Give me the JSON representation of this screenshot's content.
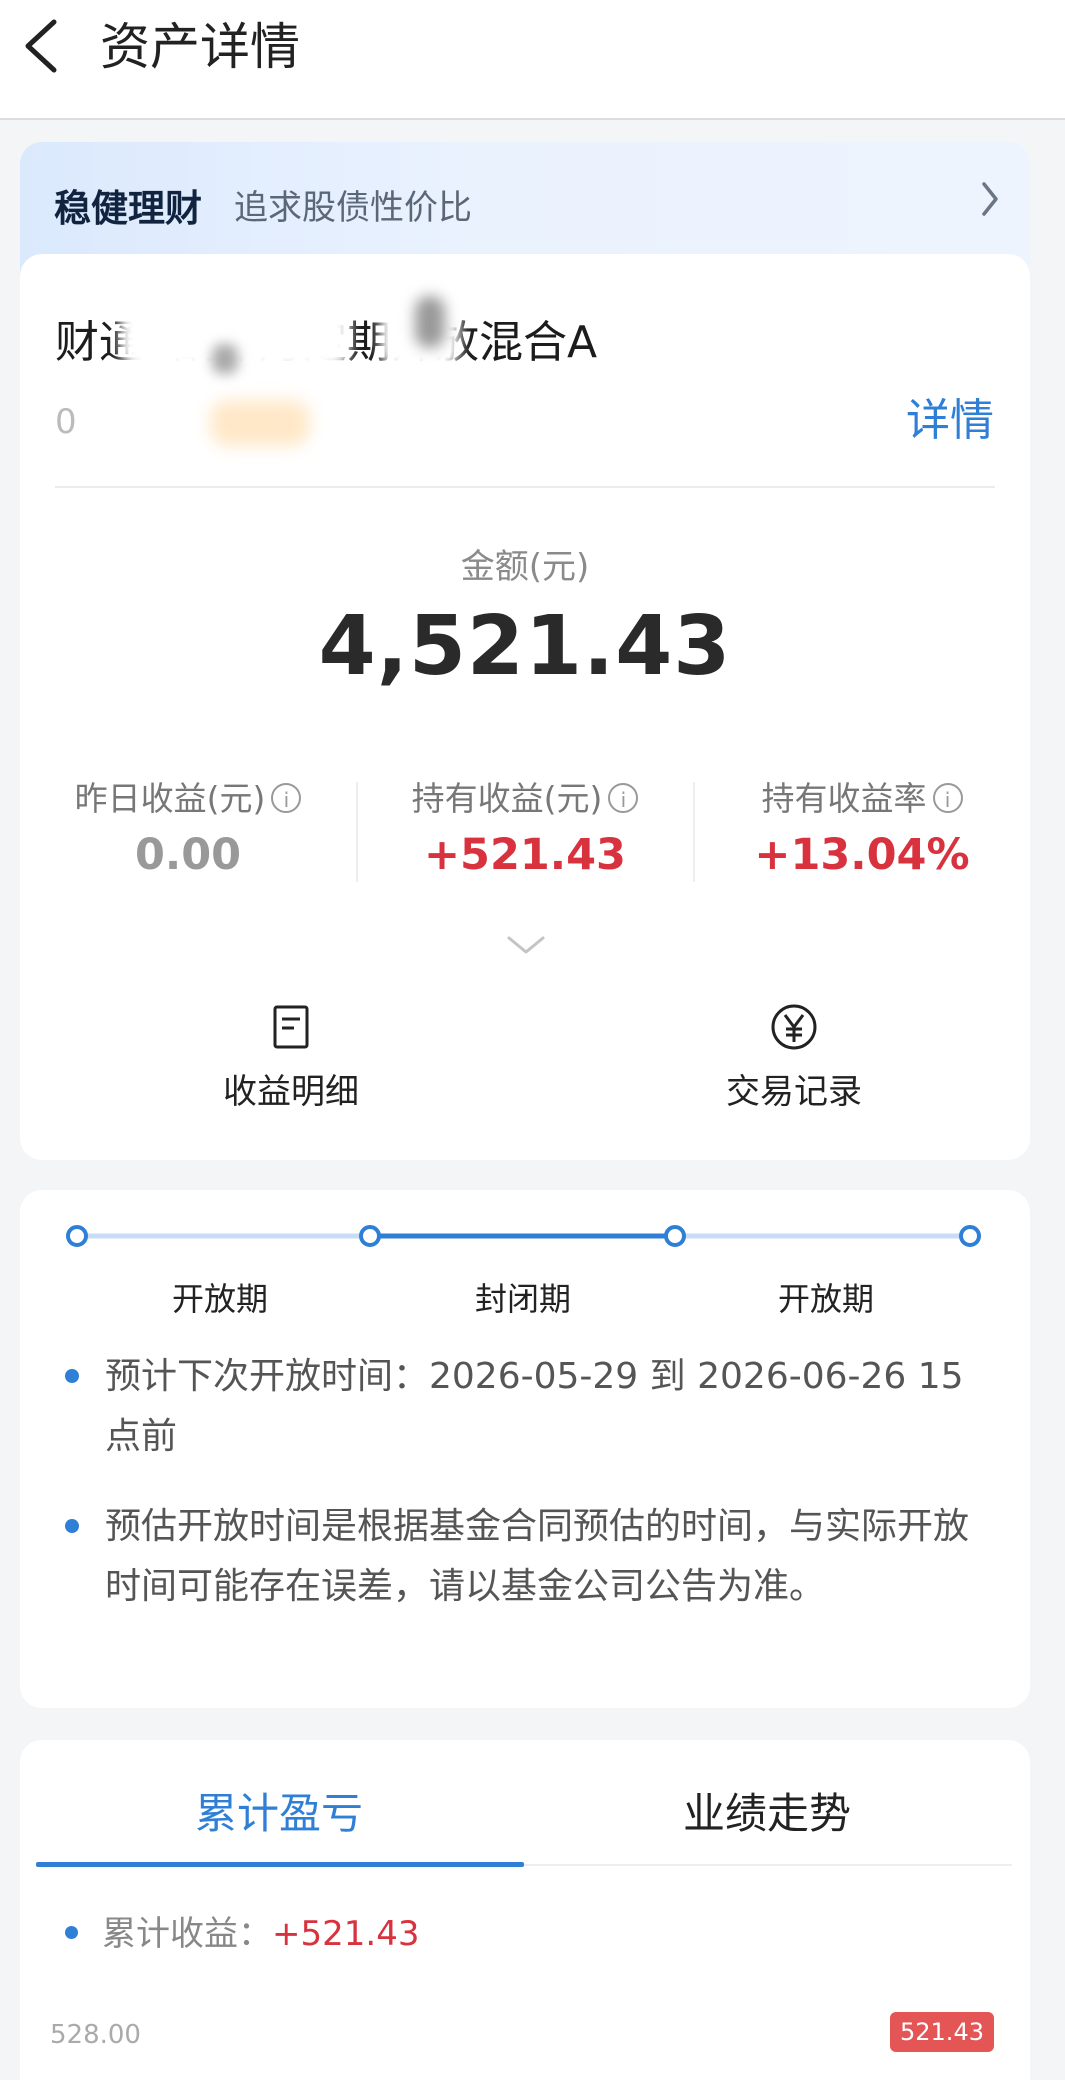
{
  "nav": {
    "title": "资产详情"
  },
  "banner": {
    "title": "稳健理财",
    "subtitle": "追求股债性价比"
  },
  "fund": {
    "name": "财通      增强          月定期开放混合A",
    "code_fragment": "0",
    "detail_link": "详情"
  },
  "amount": {
    "label": "金额(元)",
    "value": "4,521.43"
  },
  "stats": [
    {
      "label": "昨日收益(元)",
      "value": "0.00",
      "color": "#999999"
    },
    {
      "label": "持有收益(元)",
      "value": "+521.43",
      "color": "#d8323f"
    },
    {
      "label": "持有收益率",
      "value": "+13.04%",
      "color": "#d8323f"
    }
  ],
  "actions": [
    {
      "label": "收益明细",
      "icon": "document-icon"
    },
    {
      "label": "交易记录",
      "icon": "yen-circle-icon"
    }
  ],
  "timeline": {
    "phases": [
      "开放期",
      "封闭期",
      "开放期"
    ],
    "notes": [
      "预计下次开放时间：2026-05-29 到 2026-06-26 15点前",
      "预估开放时间是根据基金合同预估的时间，与实际开放时间可能存在误差，请以基金公司公告为准。"
    ]
  },
  "tabs": {
    "items": [
      "累计盈亏",
      "业绩走势"
    ],
    "active": 0
  },
  "cumulative": {
    "label": "累计收益：",
    "value": "+521.43"
  },
  "chart_preview": {
    "y_tick": "528.00",
    "tooltip": "521.43"
  },
  "colors": {
    "accent": "#2f7fd6",
    "gain": "#d8323f"
  }
}
